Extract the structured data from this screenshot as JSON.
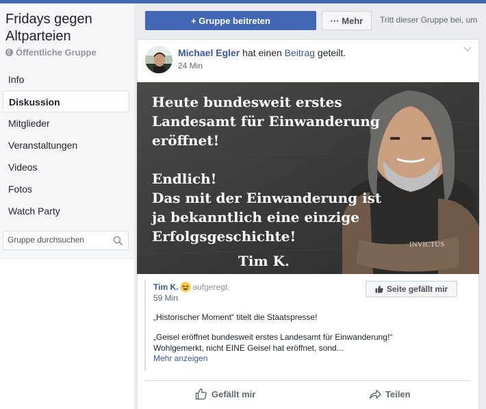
{
  "group": {
    "name": "Fridays gegen Altparteien",
    "type_label": "Öffentliche Gruppe"
  },
  "sidebar": {
    "items": [
      {
        "label": "Info"
      },
      {
        "label": "Diskussion",
        "active": true
      },
      {
        "label": "Mitglieder"
      },
      {
        "label": "Veranstaltungen"
      },
      {
        "label": "Videos"
      },
      {
        "label": "Fotos"
      },
      {
        "label": "Watch Party"
      }
    ],
    "search_placeholder": "Gruppe durchsuchen"
  },
  "header": {
    "join_label": "+ Gruppe beitreten",
    "more_label": "··· Mehr",
    "hint": "Tritt dieser Gruppe bei, um"
  },
  "post": {
    "author": "Michael Egler",
    "action_text": " hat einen ",
    "link_text": "Beitrag",
    "action_suffix": " geteilt.",
    "time": "24 Min",
    "image_text": {
      "line1": "Heute bundesweit erstes",
      "line2": "Landesamt für Einwanderung",
      "line3": "eröffnet!",
      "line4": "Endlich!",
      "line5": "Das mit der Einwanderung ist",
      "line6": "ja bekanntlich eine einzige",
      "line7": "Erfolgsgeschichte!",
      "signature": "Tim K.",
      "vest_text": "INVICTUS"
    },
    "shared": {
      "author": "Tim K.",
      "feeling": "aufgeregt.",
      "time": "59 Min",
      "like_page_label": "Seite gefällt mir",
      "text1": "„Historischer Moment“ titelt die Staatspresse!",
      "text2": "„Geisel eröffnet bundesweit erstes Landesamt für Einwanderung!“ Wohlgemerkt, nicht EINE Geisel hat eröffnet, sond...",
      "see_more": "Mehr anzeigen"
    },
    "actions": {
      "like": "Gefällt mir",
      "share": "Teilen"
    }
  },
  "colors": {
    "brand": "#4267b2",
    "link": "#365899",
    "sidebar_bg": "#f5f6f7",
    "page_bg": "#e9ebee"
  }
}
